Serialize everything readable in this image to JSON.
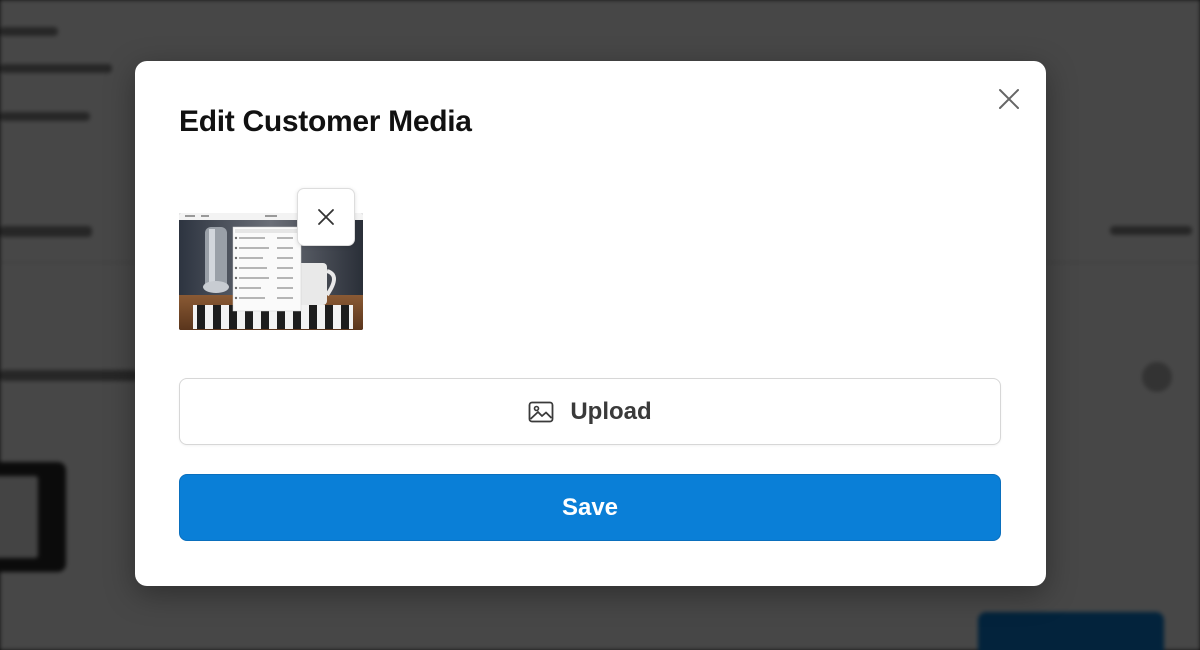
{
  "modal": {
    "title": "Edit Customer Media",
    "close_icon": "close-icon",
    "media": {
      "thumbnail_icon": "media-thumbnail",
      "remove_icon": "close-icon"
    },
    "upload": {
      "label": "Upload",
      "icon": "image-icon"
    },
    "save": {
      "label": "Save"
    }
  },
  "colors": {
    "primary": "#0a7fd7",
    "overlay": "#3c3c3c",
    "title_text": "#111111",
    "upload_text": "#3a3a3a"
  }
}
